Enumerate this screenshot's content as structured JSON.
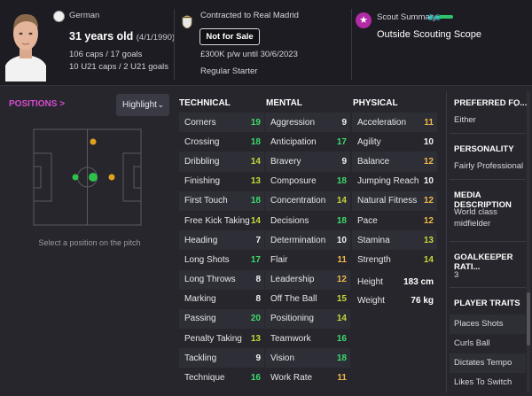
{
  "header": {
    "nationality": "German",
    "age": "31 years old",
    "dob": "(4/1/1990)",
    "caps_line1": "106 caps / 17 goals",
    "caps_line2": "10 U21 caps / 2 U21 goals",
    "contract": "Contracted to Real Madrid",
    "transfer_status": "Not for Sale",
    "wage": "£300K p/w until 30/6/2023",
    "squad_status": "Regular Starter",
    "scout_title": "Scout Summary",
    "scout_text": "Outside Scouting Scope"
  },
  "positions": {
    "link": "POSITIONS >",
    "highlight": "Highlight",
    "hint": "Select a position on the pitch"
  },
  "attributes": {
    "technical_header": "TECHNICAL",
    "mental_header": "MENTAL",
    "physical_header": "PHYSICAL",
    "technical": [
      {
        "name": "Corners",
        "value": "19"
      },
      {
        "name": "Crossing",
        "value": "18"
      },
      {
        "name": "Dribbling",
        "value": "14"
      },
      {
        "name": "Finishing",
        "value": "13"
      },
      {
        "name": "First Touch",
        "value": "18"
      },
      {
        "name": "Free Kick Taking",
        "value": "14"
      },
      {
        "name": "Heading",
        "value": "7"
      },
      {
        "name": "Long Shots",
        "value": "17"
      },
      {
        "name": "Long Throws",
        "value": "8"
      },
      {
        "name": "Marking",
        "value": "8"
      },
      {
        "name": "Passing",
        "value": "20"
      },
      {
        "name": "Penalty Taking",
        "value": "13"
      },
      {
        "name": "Tackling",
        "value": "9"
      },
      {
        "name": "Technique",
        "value": "16"
      }
    ],
    "mental": [
      {
        "name": "Aggression",
        "value": "9"
      },
      {
        "name": "Anticipation",
        "value": "17"
      },
      {
        "name": "Bravery",
        "value": "9"
      },
      {
        "name": "Composure",
        "value": "18"
      },
      {
        "name": "Concentration",
        "value": "14"
      },
      {
        "name": "Decisions",
        "value": "18"
      },
      {
        "name": "Determination",
        "value": "10"
      },
      {
        "name": "Flair",
        "value": "11"
      },
      {
        "name": "Leadership",
        "value": "12"
      },
      {
        "name": "Off The Ball",
        "value": "15"
      },
      {
        "name": "Positioning",
        "value": "14"
      },
      {
        "name": "Teamwork",
        "value": "16"
      },
      {
        "name": "Vision",
        "value": "18"
      },
      {
        "name": "Work Rate",
        "value": "11"
      }
    ],
    "physical": [
      {
        "name": "Acceleration",
        "value": "11"
      },
      {
        "name": "Agility",
        "value": "10"
      },
      {
        "name": "Balance",
        "value": "12"
      },
      {
        "name": "Jumping Reach",
        "value": "10"
      },
      {
        "name": "Natural Fitness",
        "value": "12"
      },
      {
        "name": "Pace",
        "value": "12"
      },
      {
        "name": "Stamina",
        "value": "13"
      },
      {
        "name": "Strength",
        "value": "14"
      }
    ],
    "height_label": "Height",
    "height": "183 cm",
    "weight_label": "Weight",
    "weight": "76 kg"
  },
  "right_panel": {
    "preferred_foot_label": "PREFERRED FO...",
    "preferred_foot": "Either",
    "personality_label": "PERSONALITY",
    "personality": "Fairly Professional",
    "media_label": "MEDIA DESCRIPTION",
    "media": "World class midfielder",
    "gk_label": "GOALKEEPER RATI...",
    "gk": "3",
    "traits_label": "PLAYER TRAITS",
    "traits": [
      "Places Shots",
      "Curls Ball",
      "Dictates Tempo",
      "Likes To Switch"
    ]
  },
  "colors": {
    "excellent": "#3ddc6b",
    "good": "#c9d93a",
    "average": "#f0b84a",
    "neutral": "#f4f4f4",
    "accent": "#d64bd0"
  }
}
